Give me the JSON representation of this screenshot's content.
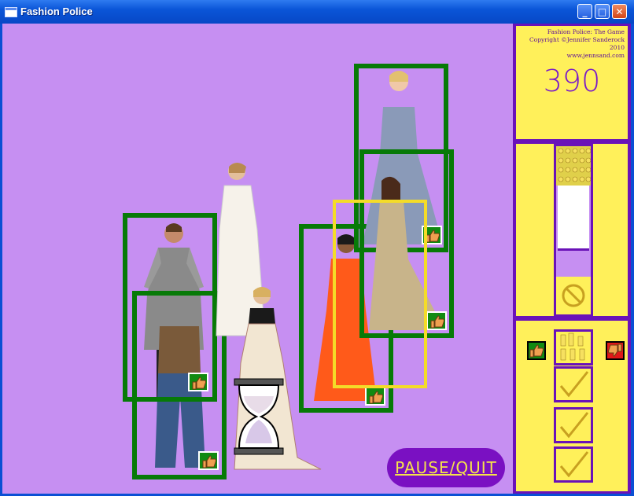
{
  "window": {
    "title": "Fashion Police",
    "minimize_icon": "minimize-icon",
    "maximize_icon": "maximize-icon",
    "close_icon": "close-icon"
  },
  "hud": {
    "credits_line1": "Fashion Police: The Game",
    "credits_line2": "Copyright ©Jennifer Sanderock 2010",
    "credits_line3": "www.jennsand.com",
    "score": "390"
  },
  "buttons": {
    "pause_quit": "PAUSE/QUIT"
  },
  "icons": {
    "thumbs_up": "thumbs-up-icon",
    "thumbs_down": "thumbs-down-icon",
    "hourglass": "hourglass-icon",
    "no": "no-entry-icon",
    "checkmark": "checkmark-icon",
    "crowd": "crowd-icon"
  },
  "colors": {
    "background": "#c68ff2",
    "sidebar": "#6a12b8",
    "panel": "#fff05a",
    "frame_green": "#077a07",
    "frame_selected": "#f4dc28",
    "score": "#7a1ac8",
    "pause_bg": "#7a10c2",
    "pause_text": "#f6e34a"
  },
  "judged_slots": 3,
  "meter_level_percent": 45
}
